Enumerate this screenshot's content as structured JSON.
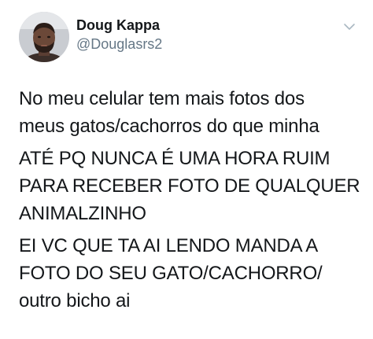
{
  "user": {
    "display_name": "Doug Kappa",
    "handle": "@Douglasrs2"
  },
  "icons": {
    "avatar": "avatar-photo",
    "menu": "chevron-down-icon"
  },
  "colors": {
    "text": "#14171a",
    "secondary_text": "#657786",
    "chevron": "#aab8c2"
  },
  "tweet": {
    "paragraphs": [
      "No meu celular tem mais fotos dos\nmeus gatos/cachorros do que minha",
      "ATÉ PQ NUNCA É UMA HORA RUIM\nPARA RECEBER FOTO DE QUALQUER\nANIMALZINHO",
      "EI VC QUE TA AI LENDO MANDA A\nFOTO DO SEU GATO/CACHORRO/\noutro bicho ai"
    ]
  }
}
